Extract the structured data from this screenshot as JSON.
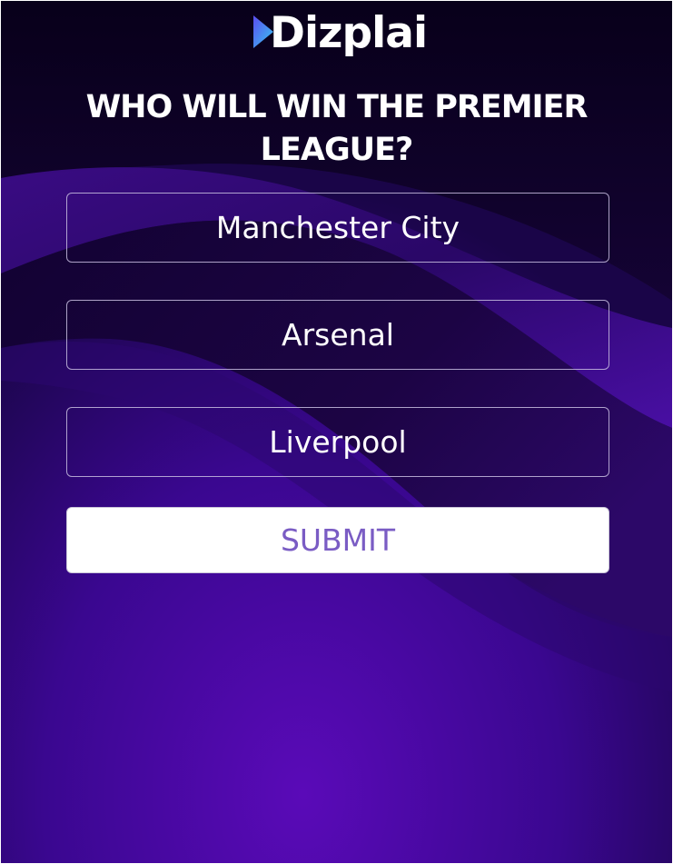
{
  "brand": {
    "logo_text": "Dizplai",
    "logo_icon": "play-icon"
  },
  "poll": {
    "question": "WHO WILL WIN THE PREMIER LEAGUE?",
    "options": [
      {
        "label": "Manchester City"
      },
      {
        "label": "Arsenal"
      },
      {
        "label": "Liverpool"
      }
    ],
    "submit_label": "SUBMIT"
  },
  "colors": {
    "background_dark": "#0b0020",
    "background_purple": "#4a0aa0",
    "submit_text": "#7a5cc4",
    "logo_gradient_start": "#5b4cf0",
    "logo_gradient_end": "#38c8f0"
  }
}
